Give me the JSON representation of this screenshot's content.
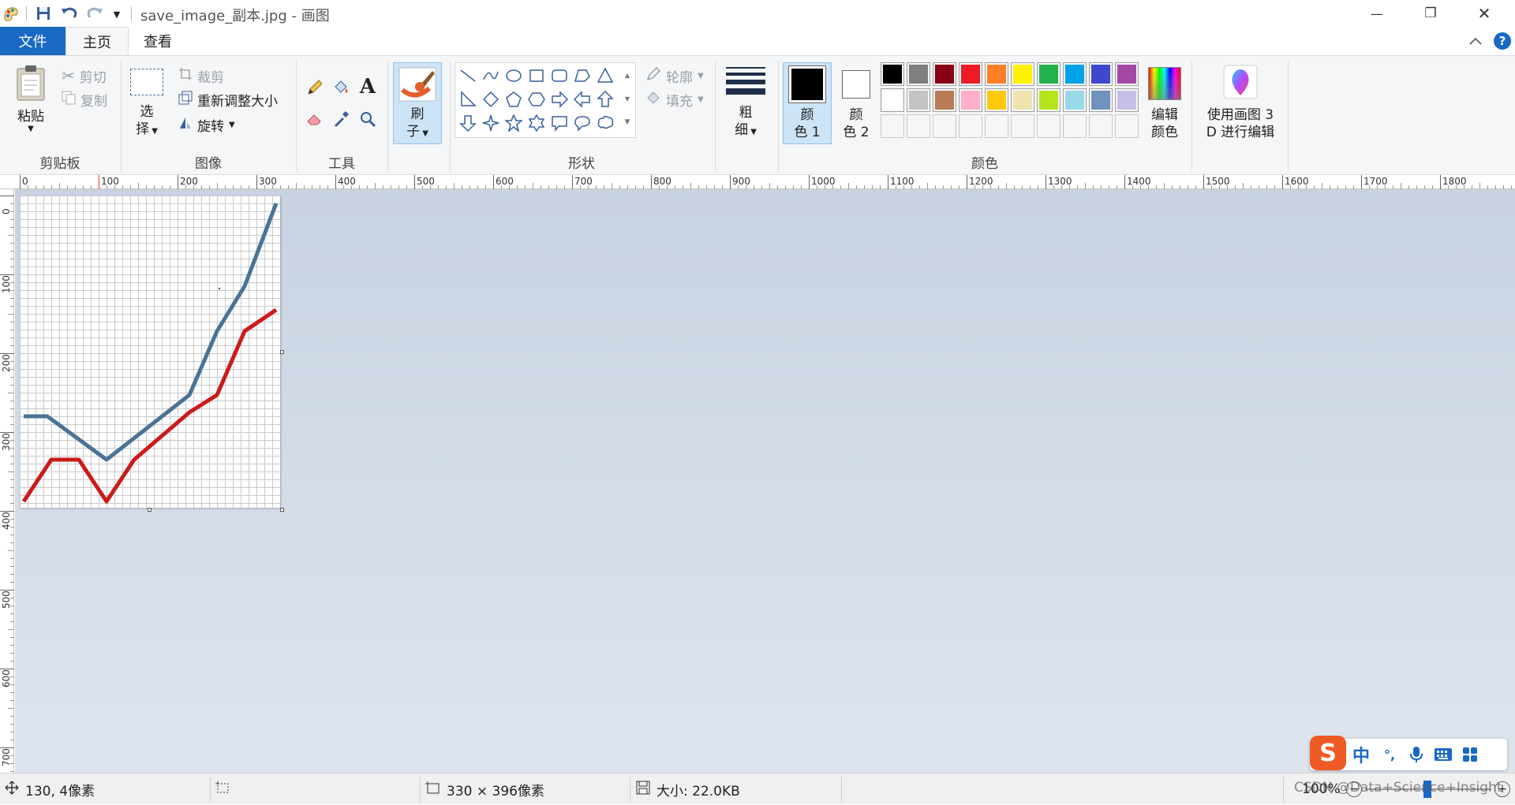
{
  "titlebar": {
    "title": "save_image_副本.jpg - 画图",
    "minimize": "—",
    "restore": "❐",
    "close": "✕"
  },
  "tabs": {
    "file": "文件",
    "home": "主页",
    "view": "查看"
  },
  "clipboard": {
    "paste": "粘贴",
    "cut": "剪切",
    "copy": "复制",
    "group": "剪贴板"
  },
  "image": {
    "select_line1": "选",
    "select_line2": "择",
    "crop": "裁剪",
    "resize": "重新调整大小",
    "rotate": "旋转",
    "group": "图像"
  },
  "tools": {
    "group": "工具"
  },
  "brushes": {
    "line1": "刷",
    "line2": "子"
  },
  "shapes": {
    "outline": "轮廓",
    "fill": "填充",
    "group": "形状"
  },
  "size": {
    "line1": "粗",
    "line2": "细"
  },
  "colors": {
    "color1_line1": "颜",
    "color1_line2": "色 1",
    "color2_line1": "颜",
    "color2_line2": "色 2",
    "edit_line1": "编辑",
    "edit_line2": "颜色",
    "group": "颜色",
    "color1_value": "#000000",
    "color2_value": "#ffffff",
    "palette_row1": [
      "#000000",
      "#7f7f7f",
      "#880015",
      "#ed1c24",
      "#ff7f27",
      "#fff200",
      "#22b14c",
      "#00a2e8",
      "#3f48cc",
      "#a349a4"
    ],
    "palette_row2": [
      "#ffffff",
      "#c3c3c3",
      "#b97a57",
      "#ffaec9",
      "#ffc90e",
      "#efe4b0",
      "#b5e61d",
      "#99d9ea",
      "#7092be",
      "#c8bfe7"
    ]
  },
  "paint3d": {
    "line1": "使用画图 3",
    "line2": "D 进行编辑"
  },
  "ruler": {
    "h_ticks": [
      "0",
      "100",
      "200",
      "300",
      "400",
      "500",
      "600",
      "700",
      "800",
      "900",
      "1000",
      "1100",
      "1200",
      "1300",
      "1400",
      "1500",
      "1600",
      "1700",
      "1800"
    ],
    "v_ticks": [
      "0",
      "100",
      "200",
      "300",
      "400",
      "500",
      "600",
      "700"
    ]
  },
  "statusbar": {
    "position": "130, 4像素",
    "dimensions": "330 × 396像素",
    "size": "大小: 22.0KB",
    "zoom": "100%",
    "watermark": "CSDN @Data+Science+Insight"
  },
  "ime": {
    "lang": "中",
    "punct": "°,"
  },
  "chart_data": {
    "type": "line",
    "xlim": [
      0,
      330
    ],
    "ylim": [
      0,
      396
    ],
    "series": [
      {
        "color": "#4a7396",
        "points": [
          [
            5,
            280
          ],
          [
            35,
            280
          ],
          [
            110,
            335
          ],
          [
            215,
            253
          ],
          [
            250,
            172
          ],
          [
            285,
            115
          ],
          [
            325,
            10
          ]
        ]
      },
      {
        "color": "#cc1a1a",
        "points": [
          [
            5,
            388
          ],
          [
            40,
            335
          ],
          [
            75,
            335
          ],
          [
            110,
            388
          ],
          [
            145,
            335
          ],
          [
            215,
            275
          ],
          [
            250,
            253
          ],
          [
            285,
            172
          ],
          [
            325,
            145
          ]
        ]
      }
    ]
  }
}
